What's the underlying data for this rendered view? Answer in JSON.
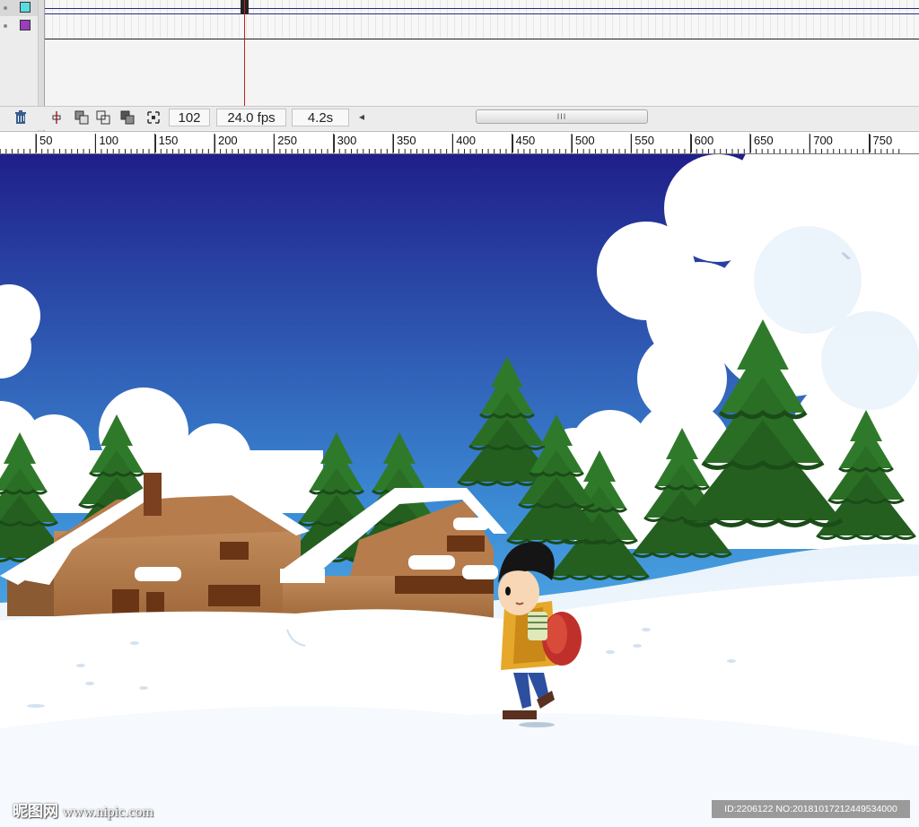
{
  "timeline": {
    "layers": [
      {
        "color": "#55dde0"
      },
      {
        "color": "#9b3dbf"
      }
    ],
    "toolbar": {
      "delete_icon": "trash-icon",
      "current_frame": "102",
      "frame_rate": "24.0 fps",
      "elapsed_time": "4.2s",
      "scroll_left_glyph": "◂",
      "scroll_thumb_grip": "III"
    }
  },
  "ruler": {
    "labels": [
      "50",
      "100",
      "150",
      "200",
      "250",
      "300",
      "350",
      "400",
      "450",
      "500",
      "550",
      "600",
      "650",
      "700",
      "750"
    ]
  },
  "stage": {
    "scene": "winter-village-cartoon",
    "sky_colors": [
      "#1f1f8a",
      "#6ad0f2"
    ]
  },
  "watermarks": {
    "left_cn": "昵图网",
    "left_site": "www.nipic.com",
    "right_id": "ID:2206122 NO:20181017212449534000"
  }
}
